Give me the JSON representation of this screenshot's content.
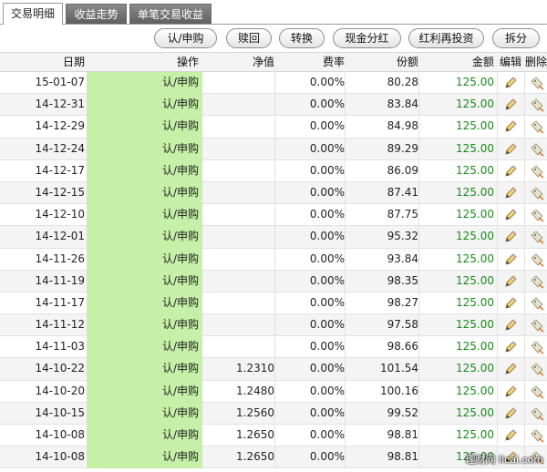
{
  "tabs": [
    {
      "label": "交易明细",
      "active": true
    },
    {
      "label": "收益走势",
      "active": false
    },
    {
      "label": "单笔交易收益",
      "active": false
    }
  ],
  "toolbar": {
    "buttons": [
      "认/申购",
      "赎回",
      "转换",
      "现金分红",
      "红利再投资",
      "拆分"
    ]
  },
  "table": {
    "headers": {
      "date": "日期",
      "op": "操作",
      "nav": "净值",
      "fee": "费率",
      "share": "份额",
      "amount": "金额",
      "edit": "编辑",
      "del": "删除"
    },
    "rows": [
      {
        "date": "15-01-07",
        "op": "认/申购",
        "nav": "",
        "fee": "0.00%",
        "share": "80.28",
        "amount": "125.00"
      },
      {
        "date": "14-12-31",
        "op": "认/申购",
        "nav": "",
        "fee": "0.00%",
        "share": "83.84",
        "amount": "125.00"
      },
      {
        "date": "14-12-29",
        "op": "认/申购",
        "nav": "",
        "fee": "0.00%",
        "share": "84.98",
        "amount": "125.00"
      },
      {
        "date": "14-12-24",
        "op": "认/申购",
        "nav": "",
        "fee": "0.00%",
        "share": "89.29",
        "amount": "125.00"
      },
      {
        "date": "14-12-17",
        "op": "认/申购",
        "nav": "",
        "fee": "0.00%",
        "share": "86.09",
        "amount": "125.00"
      },
      {
        "date": "14-12-15",
        "op": "认/申购",
        "nav": "",
        "fee": "0.00%",
        "share": "87.41",
        "amount": "125.00"
      },
      {
        "date": "14-12-10",
        "op": "认/申购",
        "nav": "",
        "fee": "0.00%",
        "share": "87.75",
        "amount": "125.00"
      },
      {
        "date": "14-12-01",
        "op": "认/申购",
        "nav": "",
        "fee": "0.00%",
        "share": "95.32",
        "amount": "125.00"
      },
      {
        "date": "14-11-26",
        "op": "认/申购",
        "nav": "",
        "fee": "0.00%",
        "share": "93.84",
        "amount": "125.00"
      },
      {
        "date": "14-11-19",
        "op": "认/申购",
        "nav": "",
        "fee": "0.00%",
        "share": "98.35",
        "amount": "125.00"
      },
      {
        "date": "14-11-17",
        "op": "认/申购",
        "nav": "",
        "fee": "0.00%",
        "share": "98.27",
        "amount": "125.00"
      },
      {
        "date": "14-11-12",
        "op": "认/申购",
        "nav": "",
        "fee": "0.00%",
        "share": "97.58",
        "amount": "125.00"
      },
      {
        "date": "14-11-03",
        "op": "认/申购",
        "nav": "",
        "fee": "0.00%",
        "share": "98.66",
        "amount": "125.00"
      },
      {
        "date": "14-10-22",
        "op": "认/申购",
        "nav": "1.2310",
        "fee": "0.00%",
        "share": "101.54",
        "amount": "125.00"
      },
      {
        "date": "14-10-20",
        "op": "认/申购",
        "nav": "1.2480",
        "fee": "0.00%",
        "share": "100.16",
        "amount": "125.00"
      },
      {
        "date": "14-10-15",
        "op": "认/申购",
        "nav": "1.2560",
        "fee": "0.00%",
        "share": "99.52",
        "amount": "125.00"
      },
      {
        "date": "14-10-08",
        "op": "认/申购",
        "nav": "1.2650",
        "fee": "0.00%",
        "share": "98.81",
        "amount": "125.00"
      },
      {
        "date": "14-10-08",
        "op": "认/申购",
        "nav": "1.2650",
        "fee": "0.00%",
        "share": "98.81",
        "amount": "125.00"
      }
    ]
  },
  "icons": {
    "edit": "pencil-edit-icon",
    "del": "tag-delete-icon"
  },
  "colors": {
    "op_bg": "#c6f0a8",
    "amount": "#1a8a1a",
    "tab_inactive": "#6f6f6f"
  },
  "watermark": "理财网 licai.com"
}
